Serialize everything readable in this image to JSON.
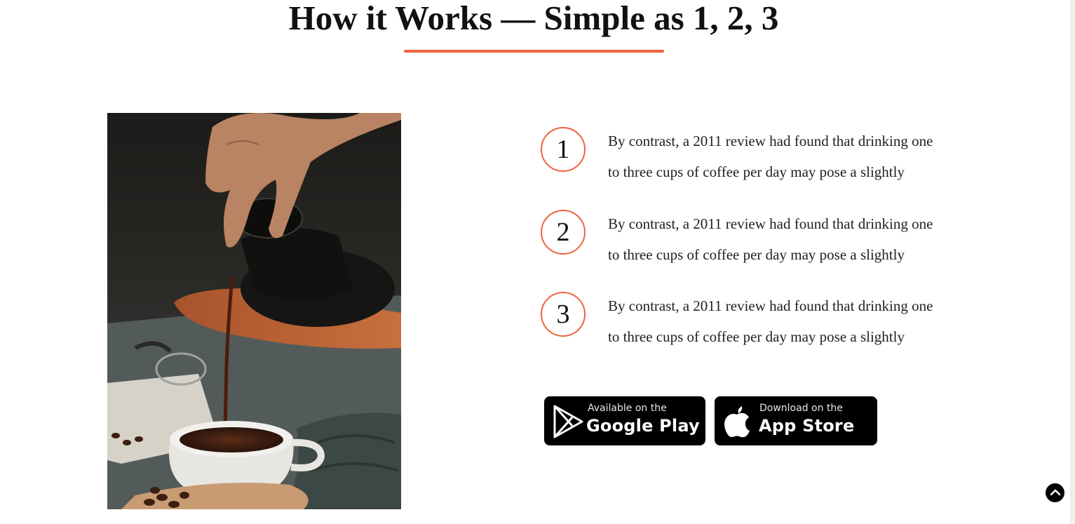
{
  "section": {
    "title": "How it Works — Simple as 1, 2, 3",
    "accent_color": "#f0623f"
  },
  "photo": {
    "icon": "coffee-pour-photo"
  },
  "steps": [
    {
      "number": "1",
      "line1": "By contrast, a 2011 review had found that drinking one",
      "line2": "to three cups of coffee per day may pose a slightly"
    },
    {
      "number": "2",
      "line1": "By contrast, a 2011 review had found that drinking one",
      "line2": "to three cups of coffee per day may pose a slightly"
    },
    {
      "number": "3",
      "line1": "By contrast, a 2011 review had found that drinking one",
      "line2": "to three cups of coffee per day may pose a slightly"
    }
  ],
  "badges": {
    "google": {
      "small": "Available on the",
      "big": "Google Play",
      "icon": "google-play-icon"
    },
    "apple": {
      "small": "Download on the",
      "big": "App Store",
      "icon": "apple-icon"
    }
  },
  "scroll_top": {
    "icon": "chevron-up-icon"
  }
}
